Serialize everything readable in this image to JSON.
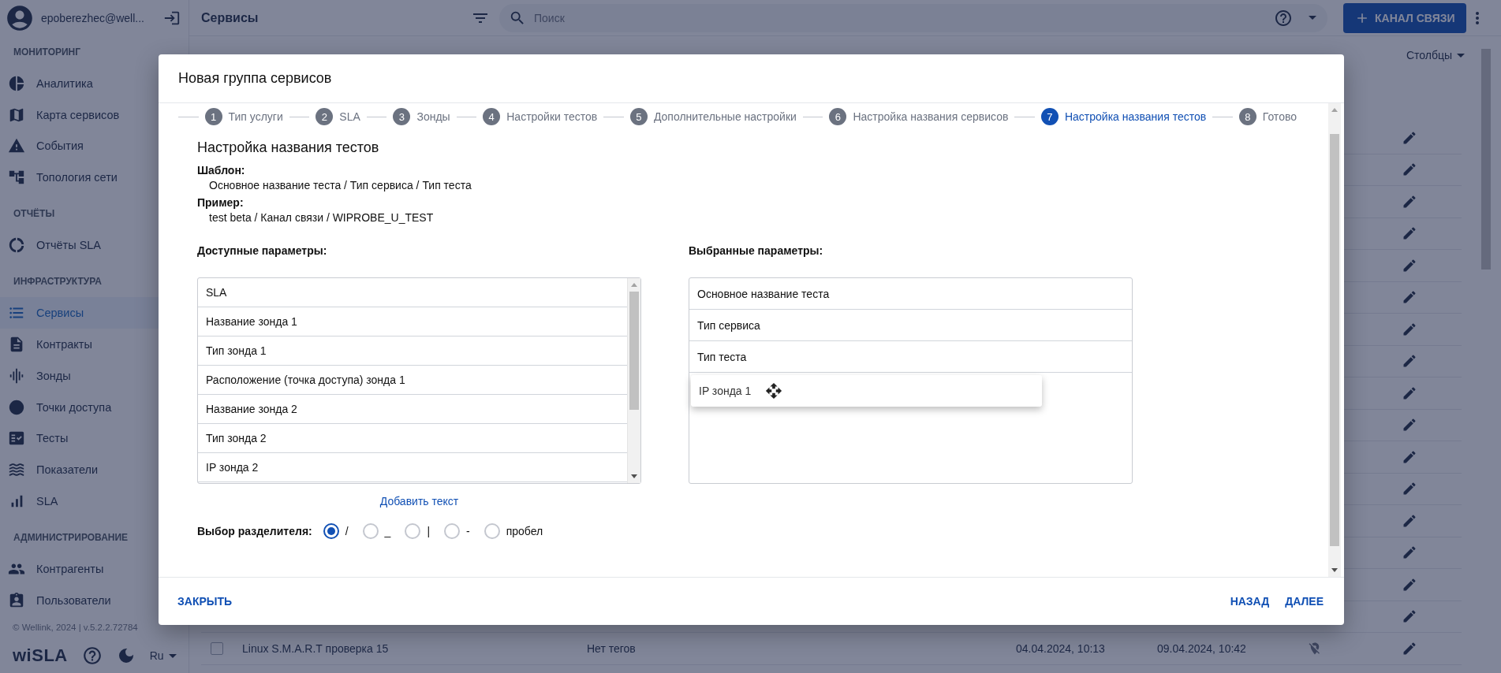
{
  "user": {
    "email": "epoberezhec@well..."
  },
  "sidebar": {
    "sections": [
      {
        "title": "МОНИТОРИНГ",
        "items": [
          {
            "label": "Аналитика",
            "selected": false
          },
          {
            "label": "Карта сервисов",
            "selected": false
          },
          {
            "label": "События",
            "selected": false
          },
          {
            "label": "Топология сети",
            "selected": false
          }
        ]
      },
      {
        "title": "ОТЧЁТЫ",
        "items": [
          {
            "label": "Отчёты SLA",
            "selected": false
          }
        ]
      },
      {
        "title": "ИНФРАСТРУКТУРА",
        "items": [
          {
            "label": "Сервисы",
            "selected": true
          },
          {
            "label": "Контракты",
            "selected": false
          },
          {
            "label": "Зонды",
            "selected": false
          },
          {
            "label": "Точки доступа",
            "selected": false
          },
          {
            "label": "Тесты",
            "selected": false
          },
          {
            "label": "Показатели",
            "selected": false
          },
          {
            "label": "SLA",
            "selected": false
          }
        ]
      },
      {
        "title": "АДМИНИСТРИРОВАНИЕ",
        "items": [
          {
            "label": "Контрагенты",
            "selected": false
          },
          {
            "label": "Пользователи",
            "selected": false
          }
        ]
      }
    ],
    "copyright": "© Wellink, 2024 | v.5.2.2.72784",
    "logo": "wiSLA",
    "language": "Ru"
  },
  "topbar": {
    "title": "Сервисы",
    "search": {
      "placeholder": "Поиск"
    },
    "add_button": "КАНАЛ СВЯЗИ"
  },
  "table": {
    "columns_button": "Столбцы",
    "rows": [
      {
        "name": "Linux S.M.A.R.T проверка 15",
        "tags": "Нет тегов",
        "created": "04.04.2024, 10:13",
        "updated": "09.04.2024, 10:42",
        "checked": false
      }
    ]
  },
  "dialog": {
    "title": "Новая группа сервисов",
    "steps": [
      {
        "number": "1",
        "label": "Тип услуги",
        "selected": false
      },
      {
        "number": "2",
        "label": "SLA",
        "selected": false
      },
      {
        "number": "3",
        "label": "Зонды",
        "selected": false
      },
      {
        "number": "4",
        "label": "Настройки тестов",
        "selected": false
      },
      {
        "number": "5",
        "label": "Дополнительные настройки",
        "selected": false
      },
      {
        "number": "6",
        "label": "Настройка названия сервисов",
        "selected": false
      },
      {
        "number": "7",
        "label": "Настройка названия тестов",
        "selected": true
      },
      {
        "number": "8",
        "label": "Готово",
        "selected": false
      }
    ],
    "heading": "Настройка названия тестов",
    "template_label": "Шаблон:",
    "template": "Основное название теста / Тип сервиса / Тип теста",
    "example_label": "Пример:",
    "example": "test beta / Канал связи / WIPROBE_U_TEST",
    "available": {
      "title": "Доступные параметры:",
      "items": [
        "SLA",
        "Название зонда 1",
        "Тип зонда 1",
        "Расположение (точка доступа) зонда 1",
        "Название зонда 2",
        "Тип зонда 2",
        "IP зонда 2"
      ]
    },
    "chosen": {
      "title": "Выбранные параметры:",
      "items": [
        "Основное название теста",
        "Тип сервиса",
        "Тип теста"
      ],
      "dragged_item": "IP зонда 1"
    },
    "add_text_link": "Добавить текст",
    "separator": {
      "label": "Выбор разделителя:",
      "options": [
        {
          "label": "/",
          "selected": true
        },
        {
          "label": "_",
          "selected": false
        },
        {
          "label": "|",
          "selected": false
        },
        {
          "label": "-",
          "selected": false
        },
        {
          "label": "пробел",
          "selected": false
        }
      ]
    },
    "close_button": "ЗАКРЫТЬ",
    "back_button": "НАЗАД",
    "next_button": "ДАЛЕЕ"
  }
}
